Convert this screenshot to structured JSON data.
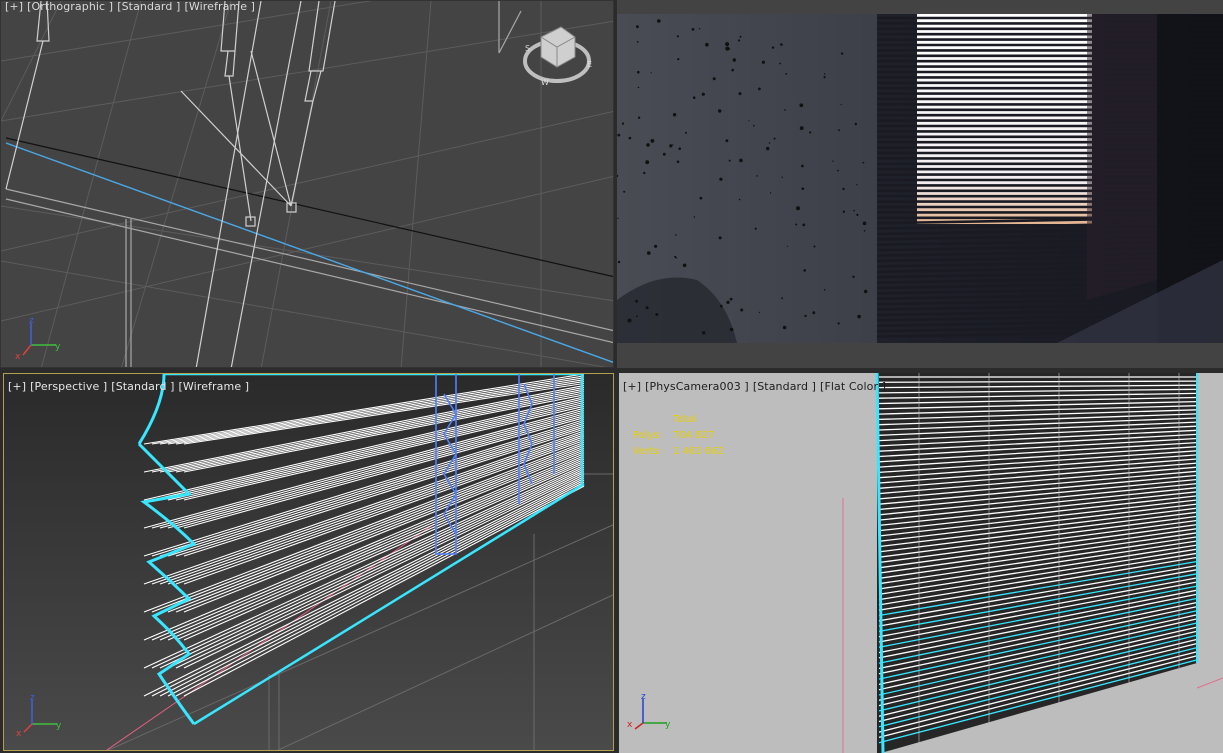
{
  "viewports": {
    "top_left": {
      "label_parts": [
        "[+]",
        "[Orthographic ]",
        "[Standard ]",
        "[Wireframe ]"
      ]
    },
    "top_right": {
      "type": "render-preview"
    },
    "bottom_left": {
      "label_parts": [
        "[+]",
        "[Perspective ]",
        "[Standard ]",
        "[Wireframe ]"
      ]
    },
    "bottom_right": {
      "label_parts": [
        "[+]",
        "[PhysCamera003 ]",
        "[Standard ]",
        "[Flat Color ]"
      ],
      "stats": {
        "header": "Total",
        "polys_label": "Polys:",
        "polys_value": "704 827",
        "verts_label": "Verts:",
        "verts_value": "1 463 662"
      }
    }
  },
  "axis_labels": {
    "x": "x",
    "y": "y",
    "z": "z"
  },
  "colors": {
    "selection": "#38e6ff",
    "wire": "#ffffff",
    "viewport_active_border": "#b0a050",
    "stats_text": "#e8d000"
  }
}
